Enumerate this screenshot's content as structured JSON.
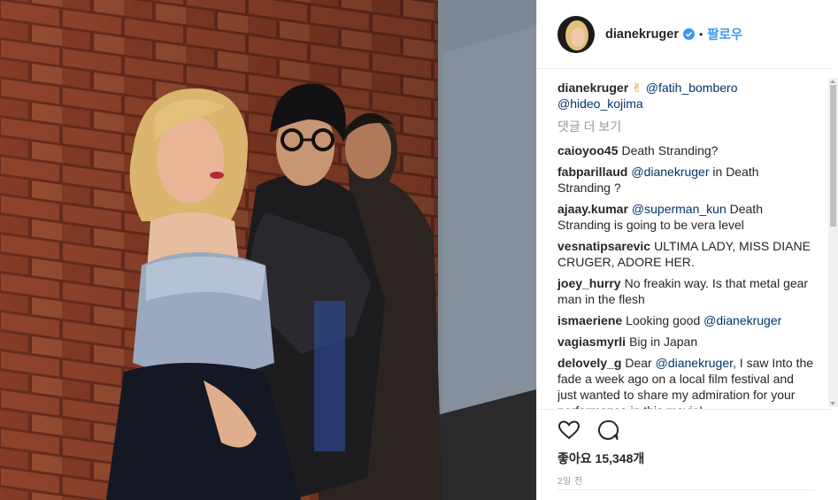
{
  "post": {
    "photo_icon": "photo-three-people-brick-wall",
    "author": "dianekruger",
    "verified_icon": "verified-badge-icon",
    "separator": "•",
    "follow_label": "팔로우",
    "caption_user": "dianekruger",
    "caption_emoji": "✌",
    "caption_mentions": [
      "@fatih_bombero",
      "@hideo_kojima"
    ],
    "more_comments_label": "댓글 더 보기",
    "likes_label": "좋아요 15,348개",
    "time_label": "2일 전"
  },
  "comments": [
    {
      "user": "caioyoo45",
      "text": "Death Stranding?",
      "mention": ""
    },
    {
      "user": "fabparillaud",
      "mention": "@dianekruger",
      "text": "in Death Stranding ?"
    },
    {
      "user": "ajaay.kumar",
      "mention": "@superman_kun",
      "text": "Death Stranding is going to be vera level"
    },
    {
      "user": "vesnatipsarevic",
      "text": "ULTIMA LADY, MISS DIANE CRUGER, ADORE HER.",
      "mention": ""
    },
    {
      "user": "joey_hurry",
      "text": "No freakin way. Is that metal gear man in the flesh",
      "mention": ""
    },
    {
      "user": "ismaeriene",
      "text": "Looking good",
      "mention": "@dianekruger"
    },
    {
      "user": "vagiasmyrli",
      "text": "Big in Japan",
      "mention": ""
    },
    {
      "user": "delovely_g",
      "text": "Dear",
      "mention": "@dianekruger",
      "text2": ", I saw Into the fade a week ago on a local film festival and just wanted to share my admiration for your performance in this movie!"
    }
  ],
  "colors": {
    "link_blue": "#3897f0",
    "mention": "#003569",
    "muted": "#999999",
    "border": "#efefef"
  },
  "icons": {
    "like": "heart-outline-icon",
    "comment": "speech-bubble-icon"
  }
}
